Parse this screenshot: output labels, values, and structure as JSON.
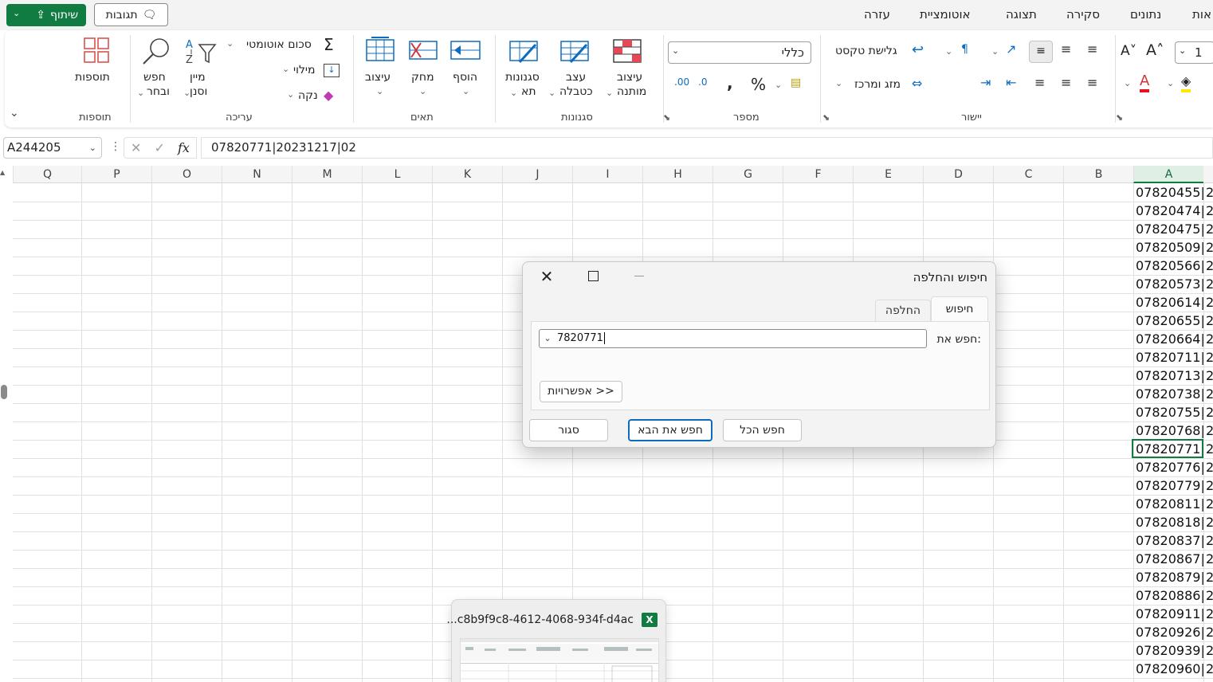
{
  "titlebar": {
    "share_label": "שיתוף",
    "comments_label": "תגובות",
    "tabs": [
      "עזרה",
      "אוטומציית",
      "תצוגה",
      "סקירה",
      "נתונים",
      "אות"
    ]
  },
  "ribbon": {
    "addins": {
      "button": "תוספות",
      "group": "תוספות"
    },
    "editing": {
      "group": "עריכה",
      "find_select": [
        "חפש",
        "ובחר"
      ],
      "sort_filter": [
        "מיין",
        "וסנן"
      ],
      "autosum": "סכום אוטומטי",
      "fill": "מילוי",
      "clear": "נקה"
    },
    "cells": {
      "group": "תאים",
      "format": "עיצוב",
      "delete": "מחק",
      "insert": "הוסף"
    },
    "styles": {
      "group": "סגנונות",
      "cell_styles": [
        "סגנונות",
        "תא"
      ],
      "format_as_table": [
        "עצב",
        "כטבלה"
      ],
      "conditional": [
        "עיצוב",
        "מותנה"
      ]
    },
    "number": {
      "group": "מספר",
      "format_value": "כללי"
    },
    "alignment": {
      "group": "יישור",
      "wrap_text": "גלישת טקסט",
      "merge_center": "מזג ומרכז"
    },
    "font_size": "1"
  },
  "formula_bar": {
    "name_box": "A244205",
    "formula": "07820771|20231217|02"
  },
  "grid": {
    "columns": [
      "Q",
      "P",
      "O",
      "N",
      "M",
      "L",
      "K",
      "J",
      "I",
      "H",
      "G",
      "F",
      "E",
      "D",
      "C",
      "B",
      "A"
    ],
    "col_a_values": [
      "07820455|",
      "07820474|",
      "07820475|",
      "07820509|",
      "07820566|",
      "07820573|",
      "07820614|",
      "07820655|",
      "07820664|",
      "07820711|",
      "07820713|",
      "07820738|",
      "07820755|",
      "07820768|",
      "07820771|",
      "07820776|",
      "07820779|",
      "07820811|",
      "07820818|",
      "07820837|",
      "07820867|",
      "07820879|",
      "07820886|",
      "07820911|",
      "07820926|",
      "07820939|",
      "07820960|"
    ],
    "col_b_prefix": "2",
    "active_row_index": 14
  },
  "find_dialog": {
    "title": "חיפוש והחלפה",
    "tab_find": "חיפוש",
    "tab_replace": "החלפה",
    "find_label": "חפש את:",
    "find_value": "7820771",
    "options_button": "אפשרויות >>",
    "find_all": "חפש הכל",
    "find_next": "חפש את הבא",
    "close": "סגור"
  },
  "taskbar_preview": {
    "title": "...c8b9f9c8-4612-4068-934f-d4ac"
  },
  "colors": {
    "accent": "#107c41",
    "focus": "#0f6cbd"
  }
}
